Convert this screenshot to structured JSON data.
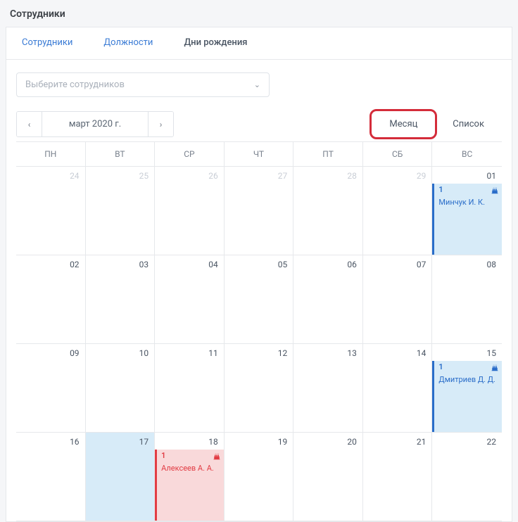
{
  "page_title": "Сотрудники",
  "tabs": [
    "Сотрудники",
    "Должности",
    "Дни рождения"
  ],
  "active_tab": 2,
  "select_placeholder": "Выберите сотрудников",
  "nav": {
    "prev": "‹",
    "next": "›",
    "label": "март 2020 г."
  },
  "views": {
    "month": "Месяц",
    "list": "Список"
  },
  "weekdays": [
    "ПН",
    "ВТ",
    "СР",
    "ЧТ",
    "ПТ",
    "СБ",
    "ВС"
  ],
  "days": [
    {
      "n": "24",
      "other": true
    },
    {
      "n": "25",
      "other": true
    },
    {
      "n": "26",
      "other": true
    },
    {
      "n": "27",
      "other": true
    },
    {
      "n": "28",
      "other": true
    },
    {
      "n": "29",
      "other": true
    },
    {
      "n": "01",
      "ev": {
        "count": "1",
        "name": "Минчук И. К.",
        "color": "blue"
      }
    },
    {
      "n": "02"
    },
    {
      "n": "03"
    },
    {
      "n": "04"
    },
    {
      "n": "05"
    },
    {
      "n": "06"
    },
    {
      "n": "07"
    },
    {
      "n": "08"
    },
    {
      "n": "09"
    },
    {
      "n": "10"
    },
    {
      "n": "11"
    },
    {
      "n": "12"
    },
    {
      "n": "13"
    },
    {
      "n": "14"
    },
    {
      "n": "15",
      "ev": {
        "count": "1",
        "name": "Дмитриев Д. Д.",
        "color": "blue"
      }
    },
    {
      "n": "16"
    },
    {
      "n": "17",
      "today": true
    },
    {
      "n": "18",
      "ev": {
        "count": "1",
        "name": "Алексеев А. А.",
        "color": "red"
      }
    },
    {
      "n": "19"
    },
    {
      "n": "20"
    },
    {
      "n": "21"
    },
    {
      "n": "22"
    }
  ],
  "icon_cake": "🎂"
}
